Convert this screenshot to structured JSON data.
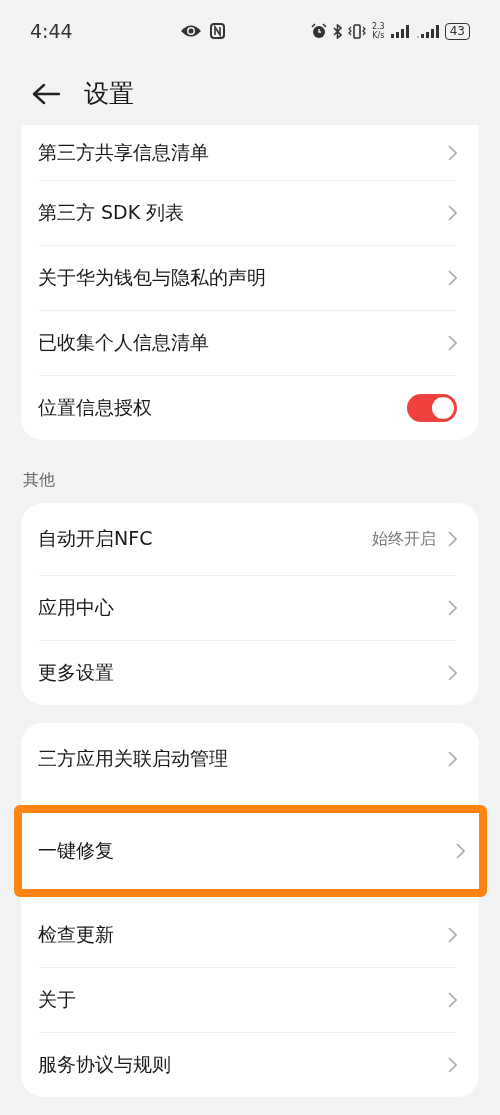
{
  "status_bar": {
    "time": "4:44",
    "speed_value": "2.3",
    "speed_unit": "K/s",
    "battery": "43"
  },
  "header": {
    "title": "设置"
  },
  "groups": [
    {
      "top_cut": true,
      "rows": [
        {
          "kind": "link",
          "label": "第三方共享信息清单",
          "highlighted": false
        },
        {
          "kind": "link",
          "label": "第三方 SDK 列表",
          "highlighted": false
        },
        {
          "kind": "link",
          "label": "关于华为钱包与隐私的声明",
          "highlighted": false
        },
        {
          "kind": "link",
          "label": "已收集个人信息清单",
          "highlighted": false
        },
        {
          "kind": "toggle",
          "label": "位置信息授权",
          "on": true,
          "highlighted": false
        }
      ]
    },
    {
      "heading": "其他",
      "top_cut": false,
      "rows": [
        {
          "kind": "link",
          "label": "自动开启NFC",
          "value": "始终开启",
          "highlighted": false
        },
        {
          "kind": "link",
          "label": "应用中心",
          "highlighted": false
        },
        {
          "kind": "link",
          "label": "更多设置",
          "highlighted": false
        }
      ]
    },
    {
      "top_cut": false,
      "rows": [
        {
          "kind": "link",
          "label": "三方应用关联启动管理",
          "highlighted": false
        },
        {
          "kind": "link",
          "label": "一键修复",
          "highlighted": true
        },
        {
          "kind": "link",
          "label": "检查更新",
          "highlighted": false
        },
        {
          "kind": "link",
          "label": "关于",
          "highlighted": false
        },
        {
          "kind": "link",
          "label": "服务协议与规则",
          "highlighted": false
        }
      ]
    }
  ]
}
